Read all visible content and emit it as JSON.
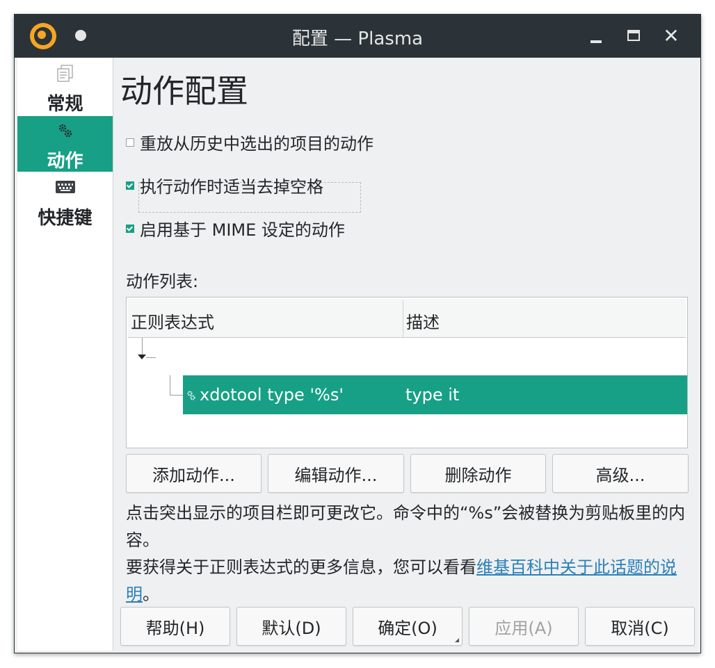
{
  "window": {
    "title": "配置 — Plasma",
    "controls": {
      "minimize": "minimize",
      "maximize": "maximize",
      "close": "✕"
    }
  },
  "sidebar": {
    "items": [
      {
        "label": "常规",
        "icon": "document-icon",
        "active": false
      },
      {
        "label": "动作",
        "icon": "gears-icon",
        "active": true
      },
      {
        "label": "快捷键",
        "icon": "keyboard-icon",
        "active": false
      }
    ]
  },
  "page": {
    "title": "动作配置",
    "options": [
      {
        "label": "重放从历史中选出的项目的动作",
        "checked": false
      },
      {
        "label": "执行动作时适当去掉空格",
        "checked": true
      },
      {
        "label": "启用基于 MIME 设定的动作",
        "checked": true
      }
    ],
    "list_label": "动作列表:",
    "table": {
      "columns": [
        "正则表达式",
        "描述"
      ],
      "rows": [
        {
          "command": "xdotool type '%s'",
          "description": "type it",
          "selected": true
        }
      ]
    },
    "action_buttons": [
      "添加动作...",
      "编辑动作...",
      "删除动作",
      "高级..."
    ],
    "info": {
      "line1": "点击突出显示的项目栏即可更改它。命令中的“%s”会被替换为剪贴板里的内容。",
      "line2_prefix": "要获得关于正则表达式的更多信息，您可以看看",
      "line2_link": "维基百科中关于此话题的说明",
      "line2_suffix": "。"
    }
  },
  "footer": {
    "buttons": [
      {
        "label": "帮助(H)",
        "enabled": true
      },
      {
        "label": "默认(D)",
        "enabled": true
      },
      {
        "label": "确定(O)",
        "enabled": true
      },
      {
        "label": "应用(A)",
        "enabled": false
      },
      {
        "label": "取消(C)",
        "enabled": true
      }
    ]
  },
  "colors": {
    "accent": "#17a086",
    "titlebar": "#2b3338",
    "link": "#2980b9"
  }
}
